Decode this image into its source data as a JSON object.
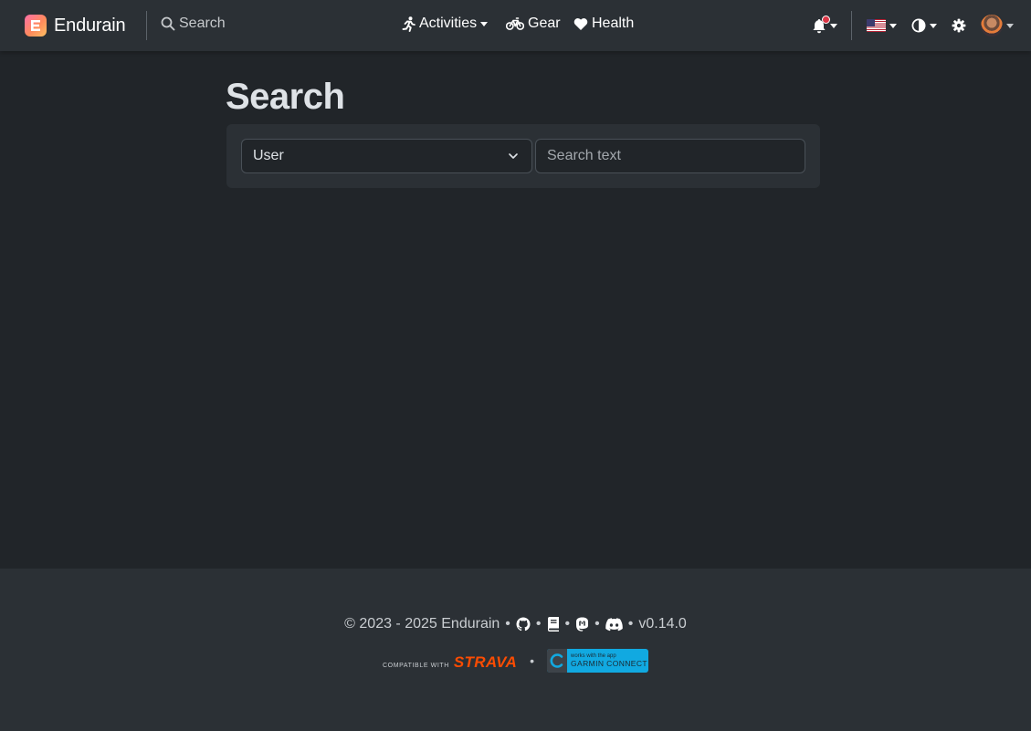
{
  "app": {
    "brand": "Endurain"
  },
  "navbar": {
    "search_label": "Search",
    "activities_label": "Activities",
    "gear_label": "Gear",
    "health_label": "Health"
  },
  "page": {
    "title": "Search"
  },
  "search_form": {
    "type_selected": "User",
    "text_placeholder": "Search text"
  },
  "footer": {
    "copyright": "© 2023 - 2025 Endurain",
    "separator": "•",
    "version": "v0.14.0",
    "strava_compatible": "COMPATIBLE WITH",
    "strava_word": "STRAVA",
    "garmin_small": "works with the app",
    "garmin_big": "GARMIN CONNECT"
  },
  "colors": {
    "background": "#212529",
    "navbar": "#2b3035",
    "notification_dot": "#dc3545",
    "strava": "#fc4c02",
    "garmin": "#11a9e1"
  },
  "icons": [
    "bell-icon",
    "us-flag-icon",
    "theme-toggle-icon",
    "gear-settings-icon",
    "user-avatar",
    "github-icon",
    "docs-icon",
    "mastodon-icon",
    "discord-icon"
  ]
}
